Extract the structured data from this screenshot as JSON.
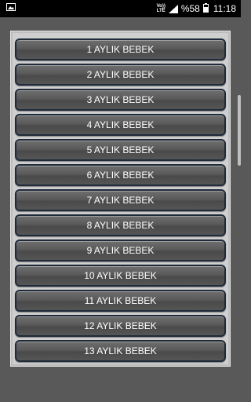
{
  "status_bar": {
    "volte_top": "Vo))",
    "volte_bottom": "LTE",
    "battery_percent": "%58",
    "time": "11:18"
  },
  "list": {
    "items": [
      {
        "label": "1 AYLIK BEBEK"
      },
      {
        "label": "2 AYLIK BEBEK"
      },
      {
        "label": "3 AYLIK BEBEK"
      },
      {
        "label": "4 AYLIK BEBEK"
      },
      {
        "label": "5 AYLIK BEBEK"
      },
      {
        "label": "6 AYLIK BEBEK"
      },
      {
        "label": "7 AYLIK BEBEK"
      },
      {
        "label": "8 AYLIK BEBEK"
      },
      {
        "label": "9 AYLIK BEBEK"
      },
      {
        "label": "10 AYLIK BEBEK"
      },
      {
        "label": "11 AYLIK BEBEK"
      },
      {
        "label": "12 AYLIK BEBEK"
      },
      {
        "label": "13 AYLIK BEBEK"
      }
    ]
  }
}
